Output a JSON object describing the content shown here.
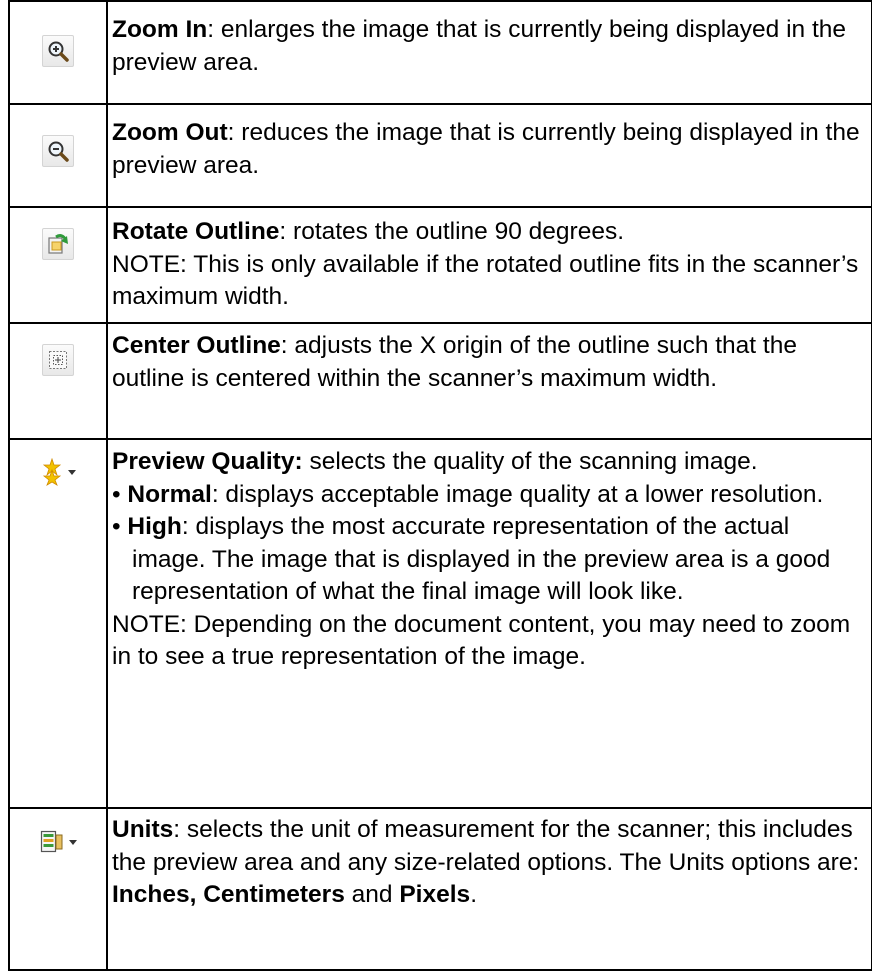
{
  "rows": [
    {
      "icon": "zoom-in-icon",
      "title": "Zoom In",
      "text": ": enlarges the image that is currently being displayed in the preview area."
    },
    {
      "icon": "zoom-out-icon",
      "title": "Zoom Out",
      "text": ": reduces the image that is currently being displayed in the preview area."
    },
    {
      "icon": "rotate-outline-icon",
      "title": "Rotate Outline",
      "text": ": rotates the outline 90 degrees.",
      "note_label": "NOTE: ",
      "note": "This is only available if the rotated outline fits in the scanner’s maximum width."
    },
    {
      "icon": "center-outline-icon",
      "title": "Center Outline",
      "text": ": adjusts the X origin of the outline such that the outline is centered within the scanner’s maximum width."
    },
    {
      "icon": "preview-quality-icon",
      "title": "Preview Quality:",
      "text": " selects the quality of the scanning image.",
      "bullets": [
        {
          "label": "Normal",
          "text": ": displays acceptable image quality at a lower resolution."
        },
        {
          "label": "High",
          "text": ": displays the most accurate representation of the actual image. The image that is displayed in the preview area is a good representation of what the final image will look like."
        }
      ],
      "note_label": "NOTE: ",
      "note": "Depending on the document content, you may need to zoom in to see a true representation of the image."
    },
    {
      "icon": "units-icon",
      "title": "Units",
      "text": ": selects the unit of measurement for the scanner; this includes the preview area and any size-related options. The Units options are: ",
      "opt1": "Inches, Centimeters",
      "and": " and ",
      "opt2": "Pixels",
      "end": "."
    }
  ],
  "colors": {
    "border": "#000000",
    "star": "#f2c200",
    "icon_green": "#3a9a3a"
  }
}
